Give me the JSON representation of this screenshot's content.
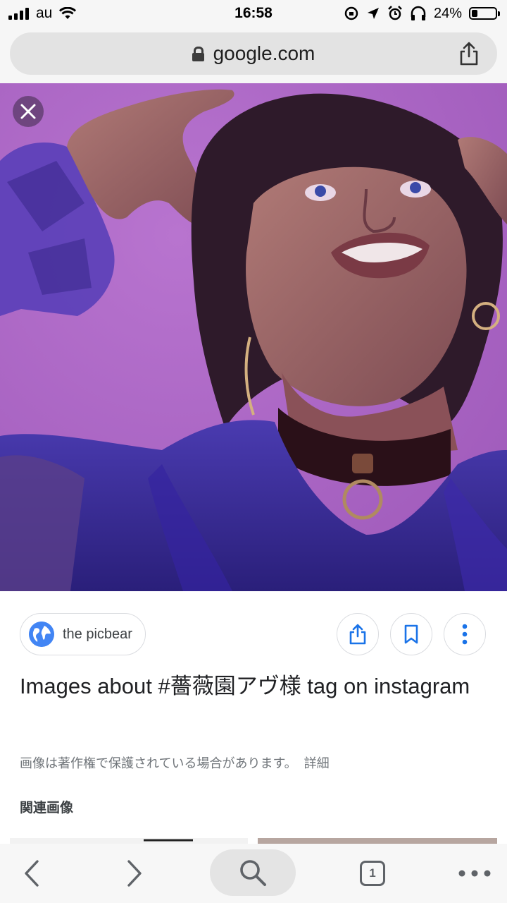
{
  "status_bar": {
    "carrier": "au",
    "time": "16:58",
    "battery_percent_text": "24%",
    "battery_level": 0.24
  },
  "url_bar": {
    "domain": "google.com",
    "icons": [
      "lock-icon",
      "share-icon"
    ]
  },
  "image_viewer": {
    "close_icon": "close-icon",
    "source": {
      "label": "the picbear",
      "icon": "globe-icon"
    },
    "actions": [
      "share-icon",
      "bookmark-icon",
      "more-vert-icon"
    ],
    "title": "Images about #薔薇園アヴ様 tag on instagram",
    "copyright_notice": "画像は著作権で保護されている場合があります。",
    "details_link": "詳細",
    "related_heading": "関連画像"
  },
  "toolbar": {
    "tab_count": "1",
    "icons": [
      "back-icon",
      "forward-icon",
      "search-icon",
      "tabs-icon",
      "more-horiz-icon"
    ]
  },
  "colors": {
    "accent": "#1a73e8",
    "background_photo": "#b366c9"
  }
}
